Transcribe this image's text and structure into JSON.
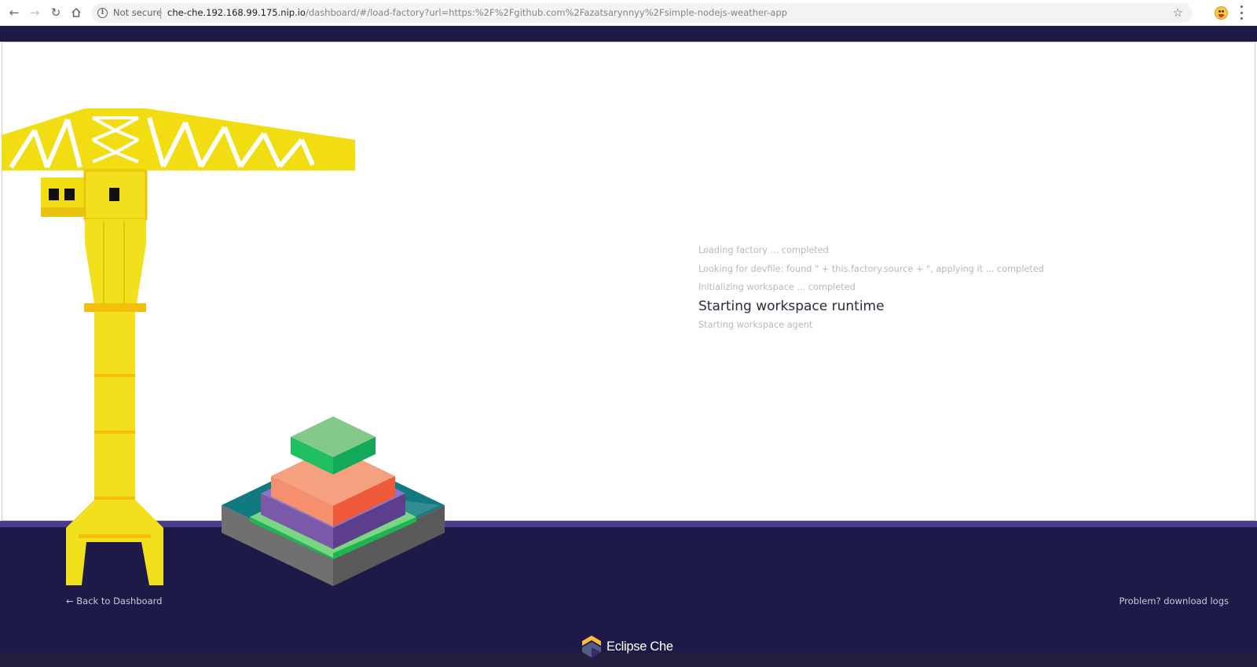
{
  "browser": {
    "security_label": "Not secure",
    "url_host": "che-che.192.168.99.175.nip.io",
    "url_path": "/dashboard/#/load-factory?url=https:%2F%2Fgithub.com%2Fazatsarynnyy%2Fsimple-nodejs-weather-app",
    "icons": [
      "back-arrow-icon",
      "forward-arrow-icon",
      "reload-icon",
      "home-icon",
      "info-icon",
      "star-icon",
      "profile-avatar",
      "menu-dots-icon"
    ]
  },
  "progress": {
    "steps": [
      {
        "text": "Loading factory ... completed",
        "state": "done"
      },
      {
        "text": "Looking for devfile: found \" + this.factory.source + \", applying it ... completed",
        "state": "done"
      },
      {
        "text": "Initializing workspace ... completed",
        "state": "done"
      },
      {
        "text": "Starting workspace runtime",
        "state": "active"
      },
      {
        "text": "Starting workspace agent",
        "state": "pending"
      }
    ]
  },
  "footer": {
    "back_link": "← Back to Dashboard",
    "logs_link": "Problem? download logs",
    "brand_name": "Eclipse Che"
  },
  "colors": {
    "band": "#1e1a47",
    "crane": "#f2e01c",
    "accent": "#fdb940"
  }
}
